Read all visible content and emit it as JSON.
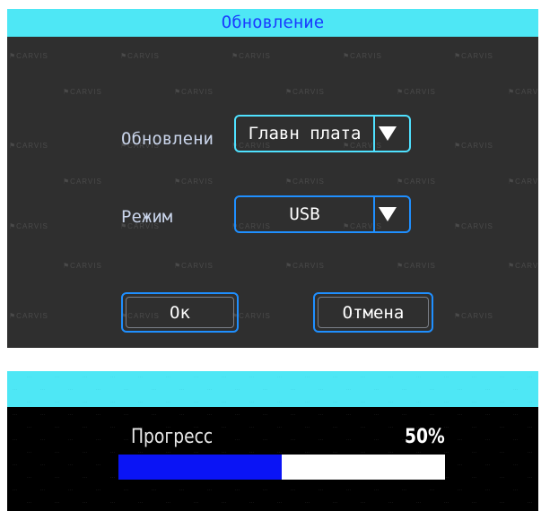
{
  "dialog": {
    "title": "Обновление",
    "watermark": "CARVIS",
    "fields": [
      {
        "label": "Обновлени",
        "value": "Главн плата"
      },
      {
        "label": "Режим",
        "value": "USB"
      }
    ],
    "ok_label": "Ок",
    "cancel_label": "Отмена"
  },
  "progress": {
    "label": "Прогресс",
    "percent_text": "50%",
    "fraction": 0.5
  },
  "colors": {
    "title_bar": "#4ee7f5",
    "title_text": "#1a3cff",
    "dialog_bg": "#2f2f2f",
    "border_blue": "#1f8fff",
    "border_cyan": "#4fe1ff",
    "progress_fill": "#0a14f5",
    "progress_track": "#ffffff"
  },
  "icons": {
    "dropdown": "triangle-down-icon"
  }
}
